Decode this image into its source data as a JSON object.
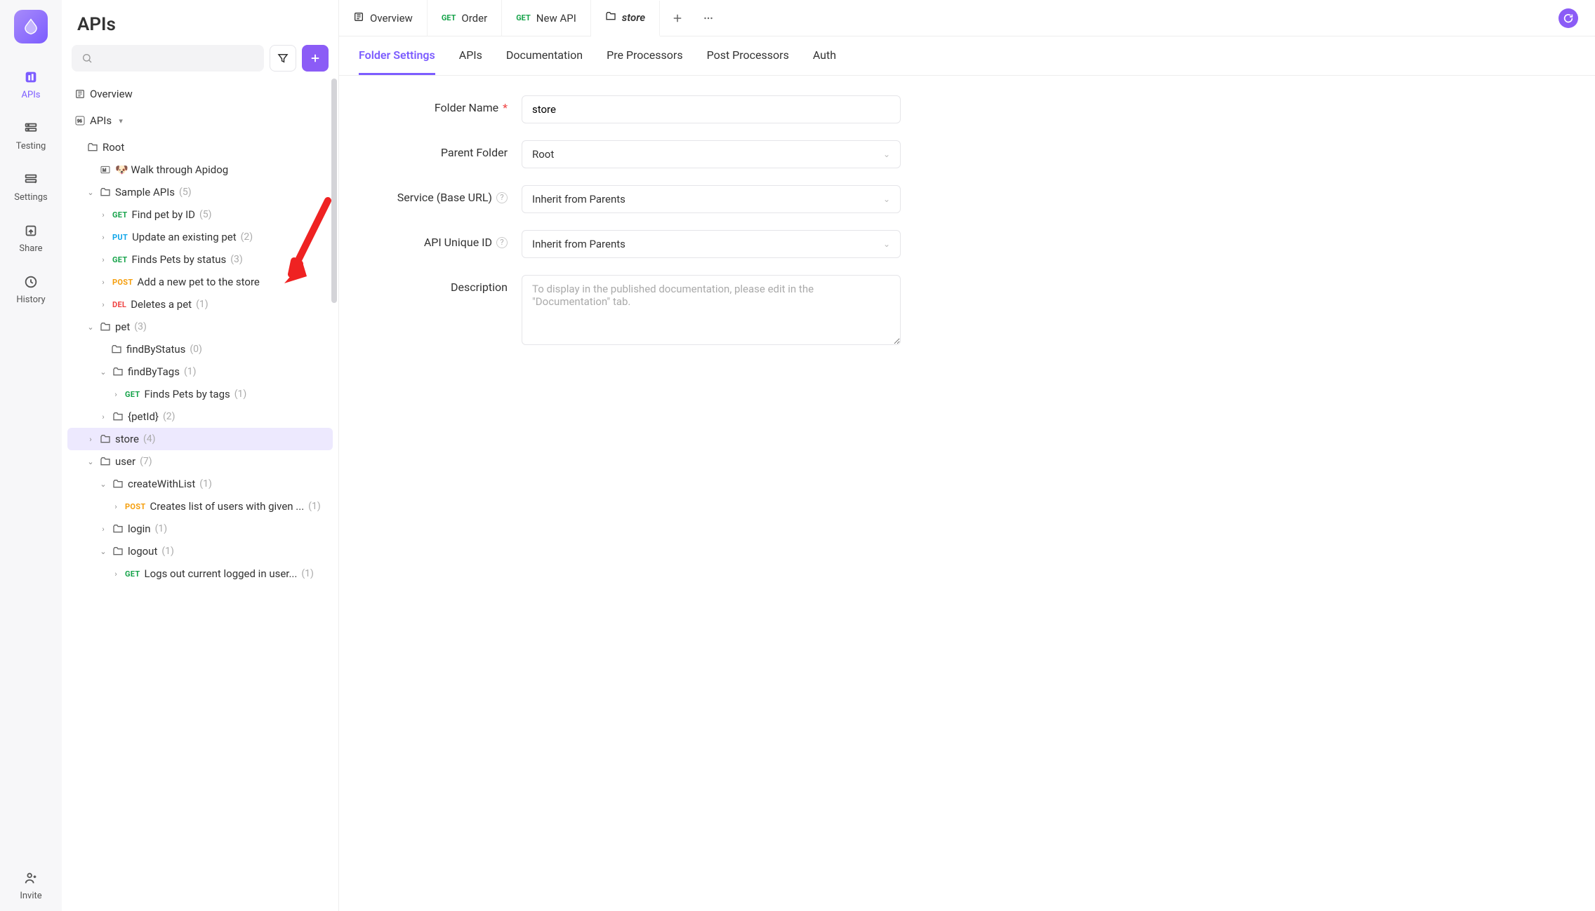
{
  "rail": {
    "items": [
      {
        "label": "APIs",
        "active": true
      },
      {
        "label": "Testing"
      },
      {
        "label": "Settings"
      },
      {
        "label": "Share"
      },
      {
        "label": "History"
      }
    ],
    "invite": "Invite"
  },
  "sidebar": {
    "title": "APIs",
    "overview_label": "Overview",
    "apis_label": "APIs",
    "tree": {
      "root": "Root",
      "walk": "🐶 Walk through Apidog",
      "sample": {
        "label": "Sample APIs",
        "count": "(5)"
      },
      "sample_children": [
        {
          "method": "GET",
          "label": "Find pet by ID",
          "count": "(5)"
        },
        {
          "method": "PUT",
          "label": "Update an existing pet",
          "count": "(2)"
        },
        {
          "method": "GET",
          "label": "Finds Pets by status",
          "count": "(3)"
        },
        {
          "method": "POST",
          "label": "Add a new pet to the store",
          "count": ""
        },
        {
          "method": "DEL",
          "label": "Deletes a pet",
          "count": "(1)"
        }
      ],
      "pet": {
        "label": "pet",
        "count": "(3)"
      },
      "findByStatus": {
        "label": "findByStatus",
        "count": "(0)"
      },
      "findByTags": {
        "label": "findByTags",
        "count": "(1)"
      },
      "findByTags_child": {
        "method": "GET",
        "label": "Finds Pets by tags",
        "count": "(1)"
      },
      "petId": {
        "label": "{petId}",
        "count": "(2)"
      },
      "store": {
        "label": "store",
        "count": "(4)"
      },
      "user": {
        "label": "user",
        "count": "(7)"
      },
      "createWithList": {
        "label": "createWithList",
        "count": "(1)"
      },
      "createWithList_child": {
        "method": "POST",
        "label": "Creates list of users with given ...",
        "count": "(1)"
      },
      "login": {
        "label": "login",
        "count": "(1)"
      },
      "logout": {
        "label": "logout",
        "count": "(1)"
      },
      "logout_child": {
        "method": "GET",
        "label": "Logs out current logged in user...",
        "count": "(1)"
      }
    }
  },
  "tabs": [
    {
      "type": "overview",
      "label": "Overview"
    },
    {
      "type": "api",
      "method": "GET",
      "label": "Order"
    },
    {
      "type": "api",
      "method": "GET",
      "label": "New API"
    },
    {
      "type": "folder",
      "label": "store",
      "active": true
    }
  ],
  "subtabs": [
    "Folder Settings",
    "APIs",
    "Documentation",
    "Pre Processors",
    "Post Processors",
    "Auth"
  ],
  "form": {
    "folder_name": {
      "label": "Folder Name",
      "value": "store"
    },
    "parent_folder": {
      "label": "Parent Folder",
      "value": "Root"
    },
    "service": {
      "label": "Service (Base URL)",
      "value": "Inherit from Parents"
    },
    "unique_id": {
      "label": "API Unique ID",
      "value": "Inherit from Parents"
    },
    "description": {
      "label": "Description",
      "placeholder": "To display in the published documentation, please edit in the \"Documentation\" tab."
    }
  }
}
